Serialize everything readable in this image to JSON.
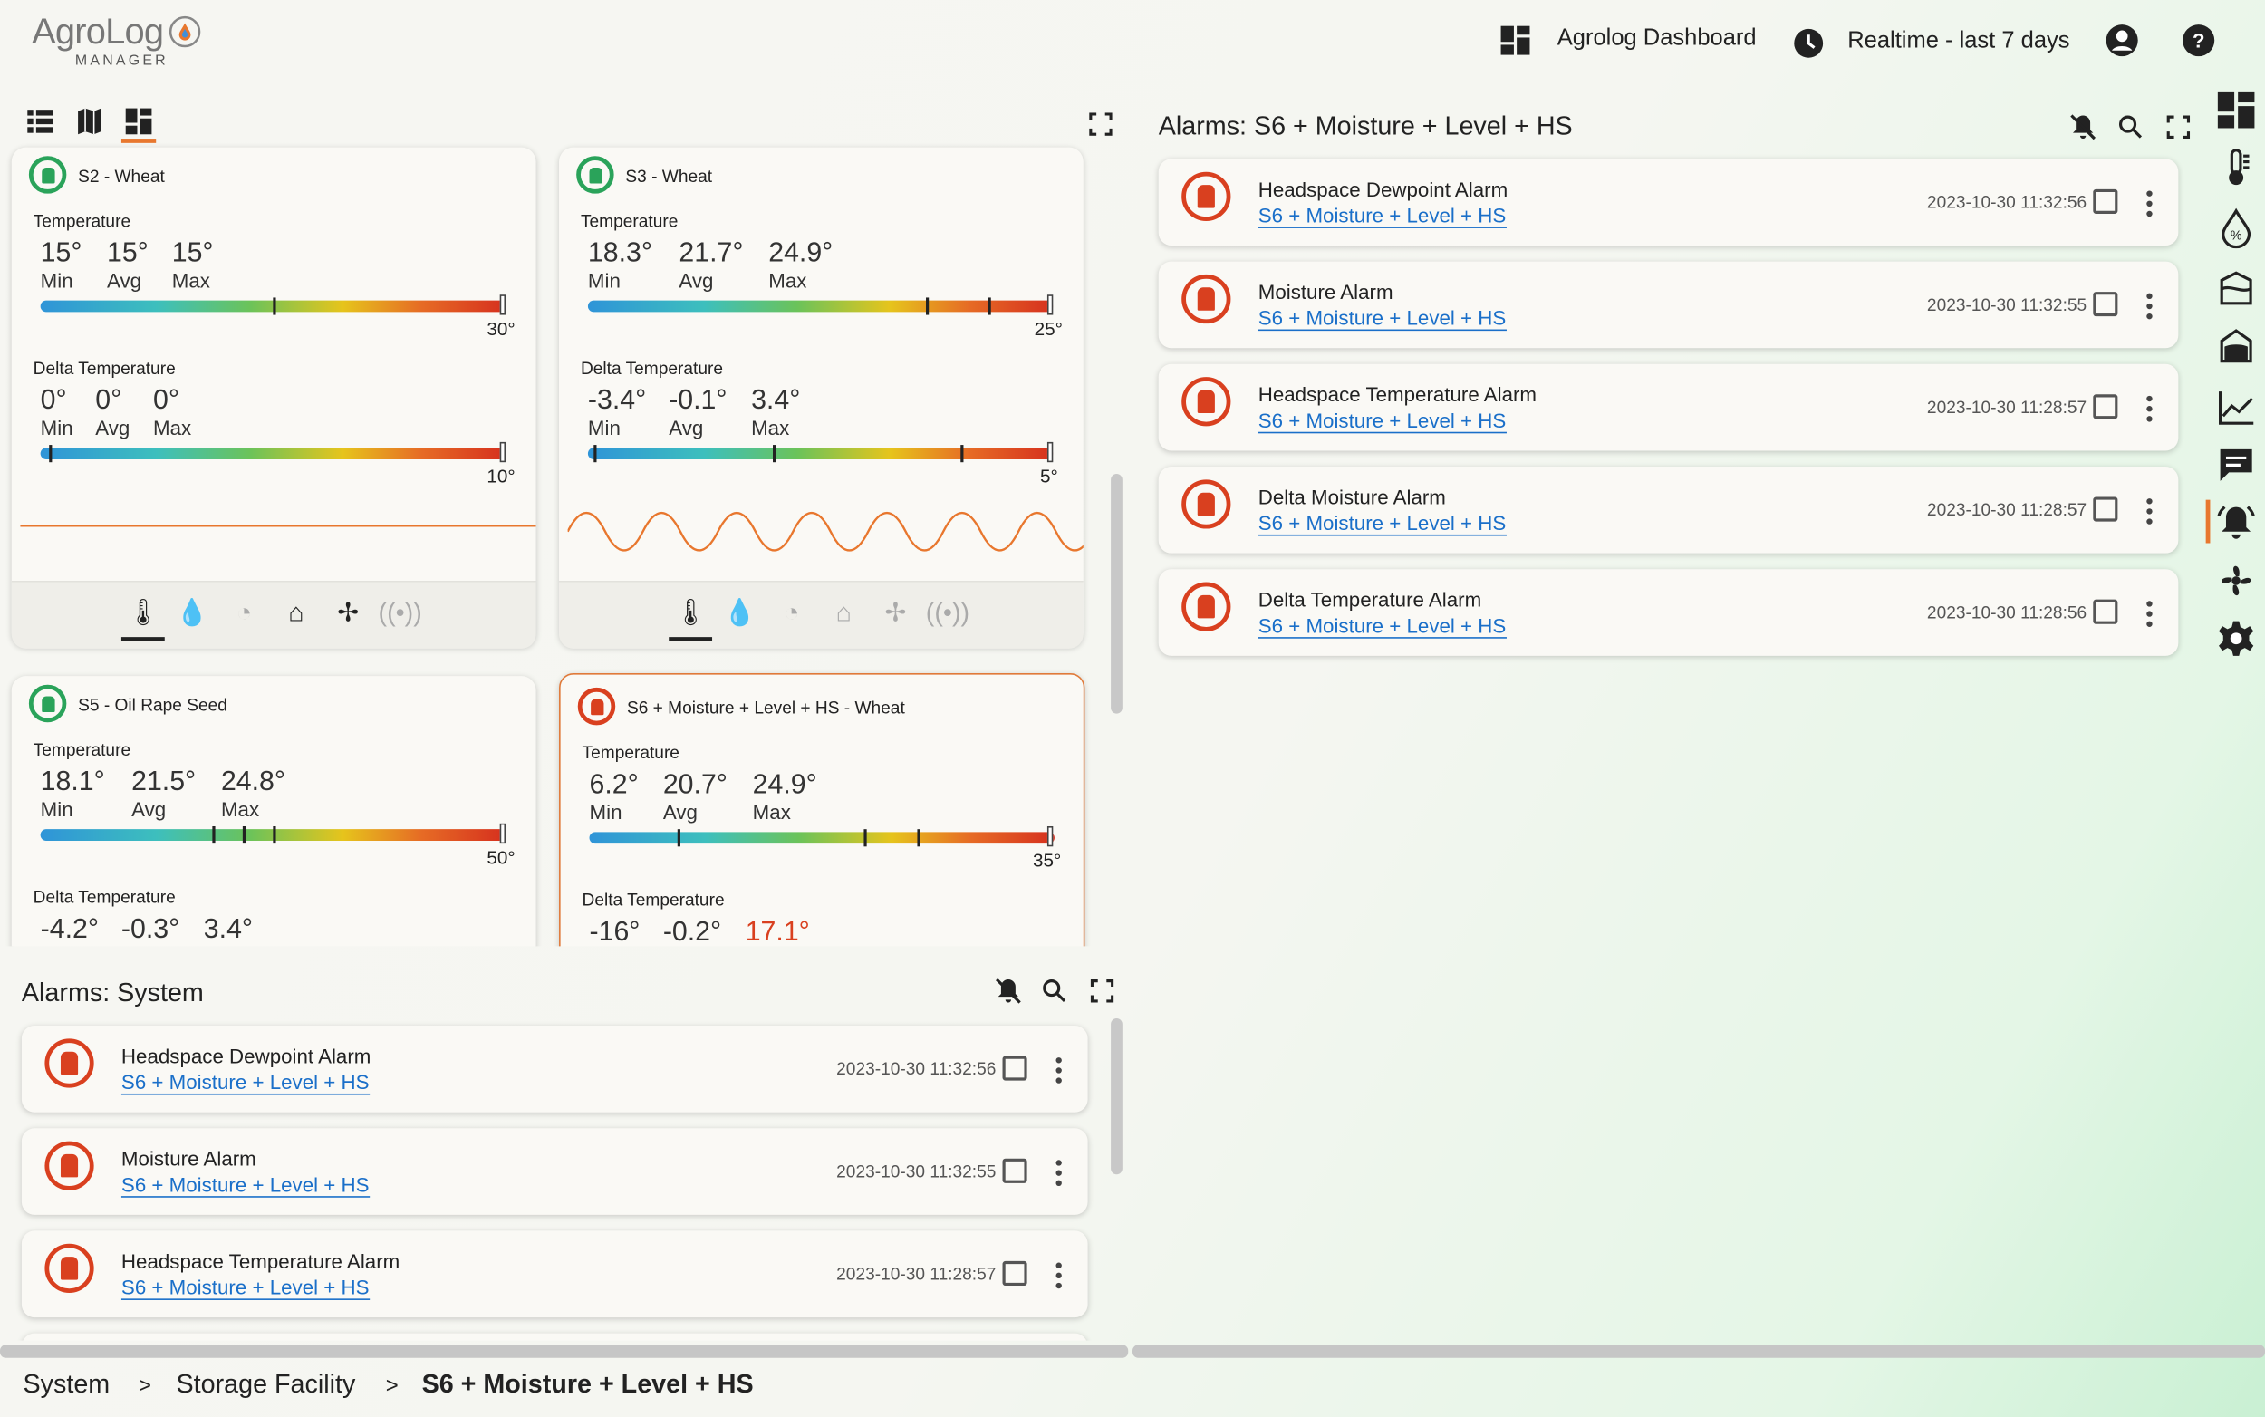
{
  "app": {
    "logo_text": "AgroLog",
    "logo_sub": "MANAGER"
  },
  "header": {
    "dashboard_label": "Agrolog Dashboard",
    "time_range_label": "Realtime - last 7 days"
  },
  "view_tabs": [
    "list-view",
    "map-view",
    "grid-view"
  ],
  "silo_cards": [
    {
      "title": "S2 - Wheat",
      "status": "ok",
      "temperature": {
        "label": "Temperature",
        "min": "15°",
        "avg": "15°",
        "max": "15°",
        "scale_max": "30°"
      },
      "delta": {
        "label": "Delta Temperature",
        "min": "0°",
        "avg": "0°",
        "max": "0°",
        "scale_max": "10°"
      }
    },
    {
      "title": "S3 - Wheat",
      "status": "ok",
      "temperature": {
        "label": "Temperature",
        "min": "18.3°",
        "avg": "21.7°",
        "max": "24.9°",
        "scale_max": "25°"
      },
      "delta": {
        "label": "Delta Temperature",
        "min": "-3.4°",
        "avg": "-0.1°",
        "max": "3.4°",
        "scale_max": "5°"
      }
    },
    {
      "title": "S5 - Oil Rape Seed",
      "status": "ok",
      "temperature": {
        "label": "Temperature",
        "min": "18.1°",
        "avg": "21.5°",
        "max": "24.8°",
        "scale_max": "50°"
      },
      "delta": {
        "label": "Delta Temperature",
        "min": "-4.2°",
        "avg": "-0.3°",
        "max": "3.4°"
      }
    },
    {
      "title": "S6 + Moisture + Level + HS - Wheat",
      "status": "alarm",
      "temperature": {
        "label": "Temperature",
        "min": "6.2°",
        "avg": "20.7°",
        "max": "24.9°",
        "scale_max": "35°"
      },
      "delta": {
        "label": "Delta Temperature",
        "min": "-16°",
        "avg": "-0.2°",
        "max": "17.1°"
      }
    }
  ],
  "stat_labels": {
    "min": "Min",
    "avg": "Avg",
    "max": "Max"
  },
  "alarms_right": {
    "title": "Alarms: S6 + Moisture + Level + HS",
    "items": [
      {
        "title": "Headspace Dewpoint Alarm",
        "link": "S6 + Moisture + Level + HS",
        "time": "2023-10-30 11:32:56"
      },
      {
        "title": "Moisture Alarm",
        "link": "S6 + Moisture + Level + HS",
        "time": "2023-10-30 11:32:55"
      },
      {
        "title": "Headspace Temperature Alarm",
        "link": "S6 + Moisture + Level + HS",
        "time": "2023-10-30 11:28:57"
      },
      {
        "title": "Delta Moisture Alarm",
        "link": "S6 + Moisture + Level + HS",
        "time": "2023-10-30 11:28:57"
      },
      {
        "title": "Delta Temperature Alarm",
        "link": "S6 + Moisture + Level + HS",
        "time": "2023-10-30 11:28:56"
      }
    ]
  },
  "alarms_system": {
    "title": "Alarms: System",
    "items": [
      {
        "title": "Headspace Dewpoint Alarm",
        "link": "S6 + Moisture + Level + HS",
        "time": "2023-10-30 11:32:56"
      },
      {
        "title": "Moisture Alarm",
        "link": "S6 + Moisture + Level + HS",
        "time": "2023-10-30 11:32:55"
      },
      {
        "title": "Headspace Temperature Alarm",
        "link": "S6 + Moisture + Level + HS",
        "time": "2023-10-30 11:28:57"
      }
    ]
  },
  "breadcrumb": {
    "items": [
      "System",
      "Storage Facility",
      "S6 + Moisture + Level + HS"
    ],
    "separator": ">"
  },
  "colors": {
    "ok": "#2aa35a",
    "alarm": "#d9401f",
    "link": "#1a6fc9",
    "active_tab": "#e8772e"
  }
}
